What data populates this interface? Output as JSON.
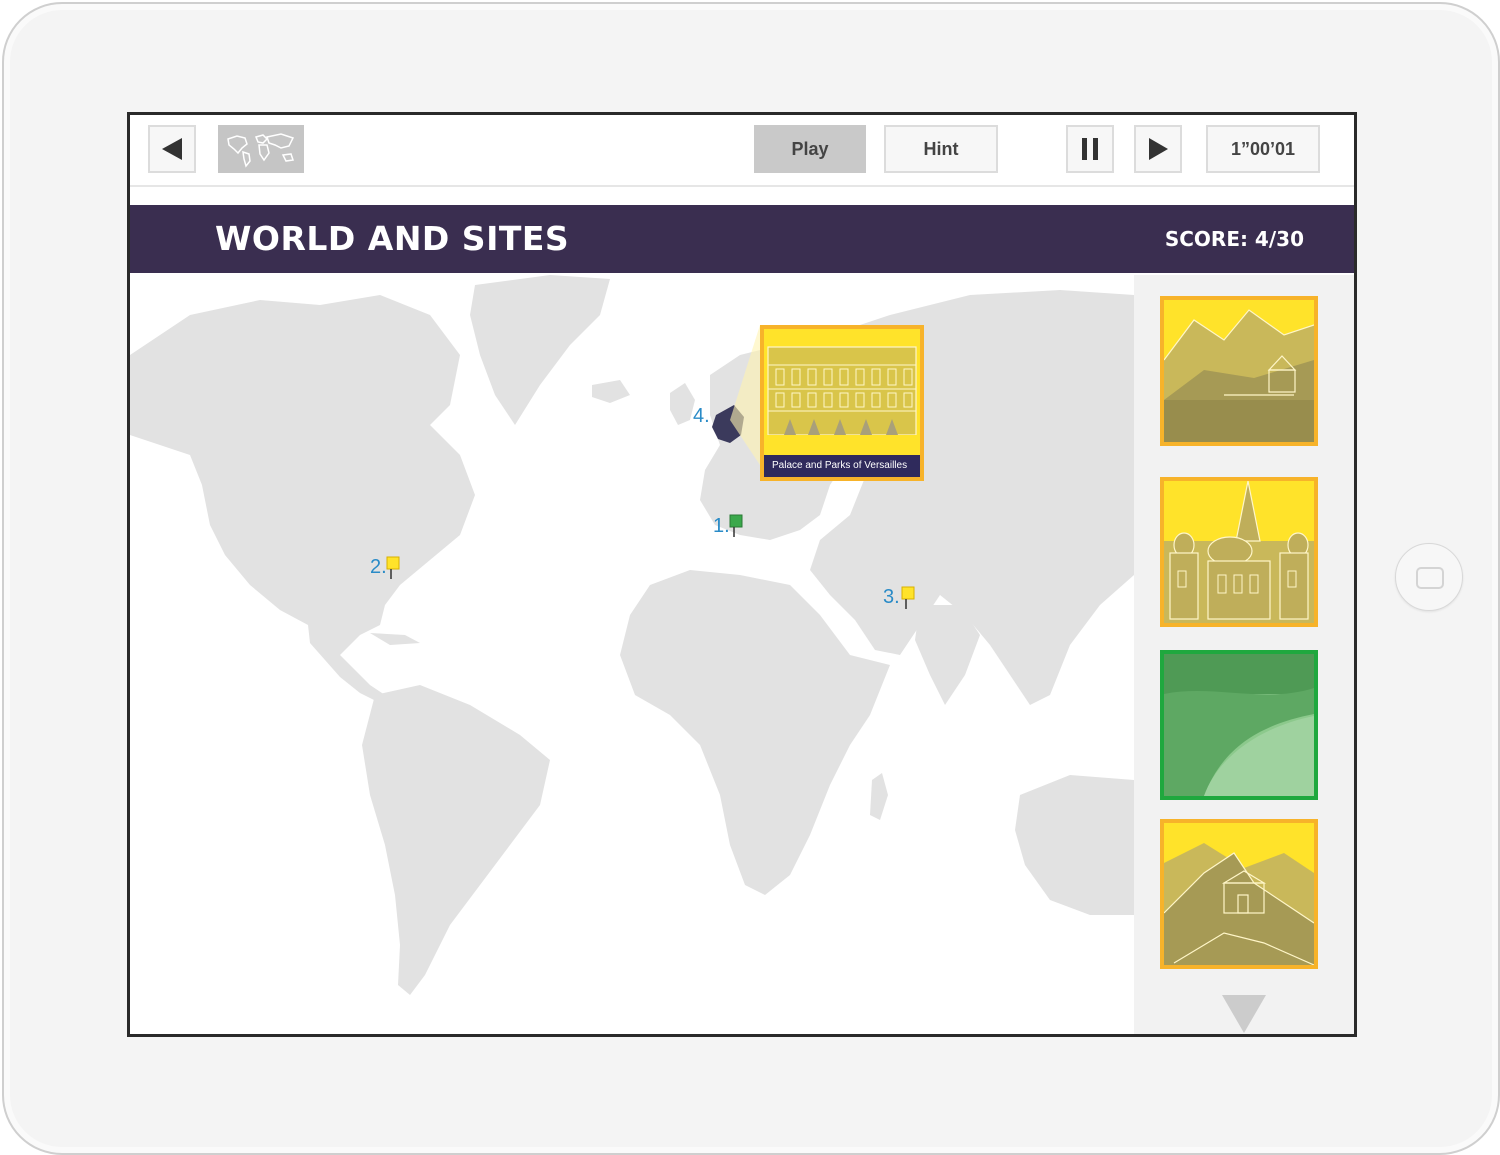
{
  "toolbar": {
    "back_icon": "back-arrow-icon",
    "map_icon": "world-map-icon",
    "play_label": "Play",
    "hint_label": "Hint",
    "pause_icon": "pause-icon",
    "next_icon": "play-icon",
    "timer": "1”00’01"
  },
  "banner": {
    "title": "WORLD AND SITES",
    "score": "SCORE: 4/30"
  },
  "map": {
    "markers": [
      {
        "label": "1.",
        "color": "#3aa84b"
      },
      {
        "label": "2.",
        "color": "#ffe32a"
      },
      {
        "label": "3.",
        "color": "#ffe32a"
      },
      {
        "label": "4.",
        "color": "#3b3a5c"
      }
    ],
    "popup": {
      "caption": "Palace and Parks of Versailles"
    }
  },
  "sidebar": {
    "cards": [
      {
        "name": "mountain-village",
        "state": "yellow"
      },
      {
        "name": "cathedral",
        "state": "yellow"
      },
      {
        "name": "coastline",
        "state": "green"
      },
      {
        "name": "great-wall",
        "state": "yellow"
      }
    ],
    "scroll_icon": "chevron-down-icon"
  },
  "colors": {
    "banner": "#3a2e50",
    "accent_yellow": "#ffe32a",
    "card_border": "#f7b32a",
    "correct_green": "#1fa83e",
    "marker_text": "#2a8bc7"
  }
}
